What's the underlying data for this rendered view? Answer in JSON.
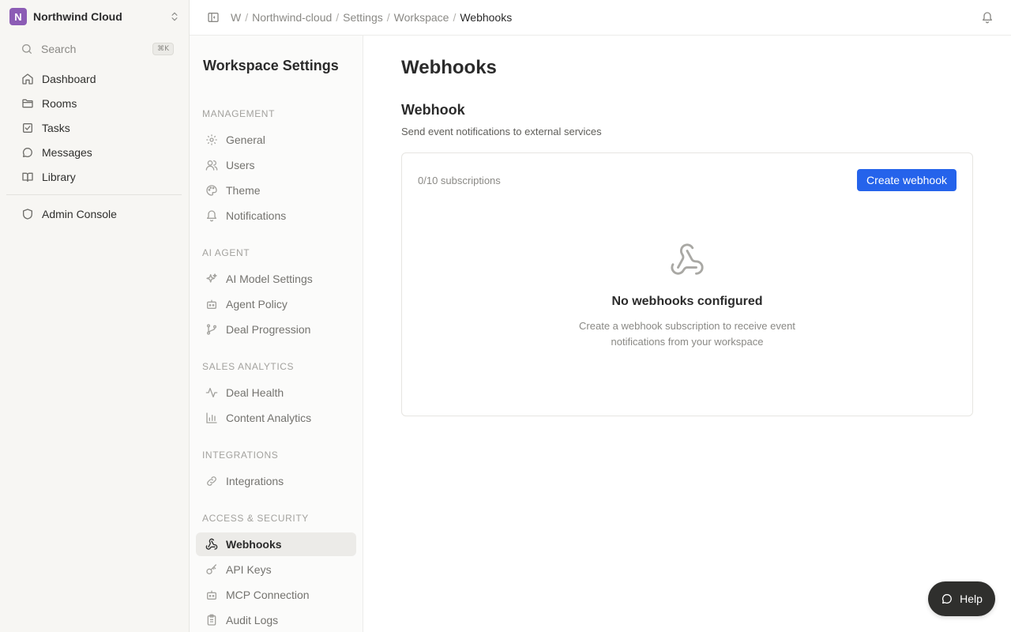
{
  "workspace": {
    "initial": "N",
    "name": "Northwind Cloud",
    "avatar_color": "#8c5cb5"
  },
  "search": {
    "label": "Search",
    "shortcut": "⌘K"
  },
  "nav": {
    "items": [
      {
        "label": "Dashboard",
        "icon": "home-icon"
      },
      {
        "label": "Rooms",
        "icon": "folder-icon"
      },
      {
        "label": "Tasks",
        "icon": "checkbox-icon"
      },
      {
        "label": "Messages",
        "icon": "chat-icon"
      },
      {
        "label": "Library",
        "icon": "book-icon"
      }
    ],
    "admin": {
      "label": "Admin Console",
      "icon": "shield-icon"
    }
  },
  "breadcrumb": [
    "W",
    "Northwind-cloud",
    "Settings",
    "Workspace",
    "Webhooks"
  ],
  "settings": {
    "title": "Workspace Settings",
    "groups": [
      {
        "label": "MANAGEMENT",
        "items": [
          "General",
          "Users",
          "Theme",
          "Notifications"
        ]
      },
      {
        "label": "AI AGENT",
        "items": [
          "AI Model Settings",
          "Agent Policy",
          "Deal Progression"
        ]
      },
      {
        "label": "SALES ANALYTICS",
        "items": [
          "Deal Health",
          "Content Analytics"
        ]
      },
      {
        "label": "INTEGRATIONS",
        "items": [
          "Integrations"
        ]
      },
      {
        "label": "ACCESS & SECURITY",
        "items": [
          "Webhooks",
          "API Keys",
          "MCP Connection",
          "Audit Logs"
        ]
      }
    ],
    "active": "Webhooks"
  },
  "main": {
    "title": "Webhooks",
    "section_title": "Webhook",
    "section_desc": "Send event notifications to external services",
    "subscription_count": "0/10 subscriptions",
    "create_button": "Create webhook",
    "empty_title": "No webhooks configured",
    "empty_desc": "Create a webhook subscription to receive event notifications from your workspace"
  },
  "help": {
    "label": "Help"
  },
  "colors": {
    "accent": "#2563eb",
    "sidebar_bg": "#f7f6f3",
    "help_bg": "#2f2f2d"
  }
}
